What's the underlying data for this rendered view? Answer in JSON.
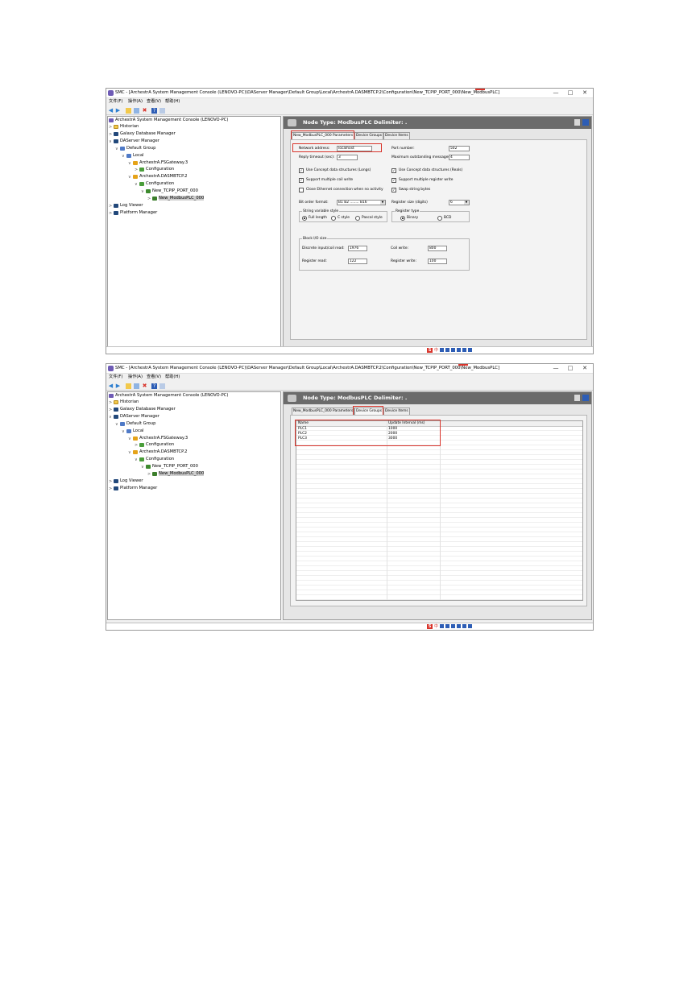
{
  "window": {
    "title": "SMC - [ArchestrA System Management Console (LENOVO-PC)\\DAServer Manager\\Default Group\\Local\\ArchestrA.DASMBTCP.2\\Configuration\\New_TCPIP_PORT_000\\New_ModbusPLC]",
    "controls": {
      "minimize": "—",
      "maximize": "8",
      "close": "✕"
    }
  },
  "menu": [
    "文件(F)",
    "操作(A)",
    "查看(V)",
    "帮助(H)"
  ],
  "toolbar_icons": [
    "back-icon",
    "forward-icon",
    "folder-icon",
    "grid-icon",
    "delete-icon",
    "help-icon",
    "window-icon"
  ],
  "tree": {
    "root": "ArchestrA System Management Console (LENOVO-PC)",
    "historian": "Historian",
    "galaxy": "Galaxy Database Manager",
    "daserver": "DAServer Manager",
    "default_group": "Default Group",
    "local": "Local",
    "fsgateway": "ArchestrA.FSGateway.3",
    "configuration": "Configuration",
    "dasmbtcp": "ArchestrA.DASMBTCP.2",
    "port": "New_TCPIP_PORT_000",
    "plc": "New_ModbusPLC_000",
    "log_viewer": "Log Viewer",
    "platform": "Platform Manager"
  },
  "header": {
    "node_type": "Node Type: ModbusPLC",
    "delimiter": "Delimiter: ."
  },
  "tabs": [
    "New_ModbusPLC_000 Parameters",
    "Device Groups",
    "Device Items"
  ],
  "params": {
    "network_address_label": "Network address:",
    "network_address_value": "localhost",
    "port_number_label": "Port number:",
    "port_number_value": "502",
    "reply_timeout_label": "Reply timeout (sec):",
    "reply_timeout_value": "3",
    "max_outstanding_label": "Maximum outstanding messages:",
    "max_outstanding_value": "4",
    "cb_concept_longs": "Use Concept data structures (Longs)",
    "cb_concept_reals": "Use Concept data structures (Reals)",
    "cb_multi_coil": "Support multiple coil write",
    "cb_multi_register": "Support multiple register write",
    "cb_close_ethernet": "Close Ethernet connection when no activity",
    "cb_swap_string": "Swap string bytes",
    "bit_order_label": "Bit order format:",
    "bit_order_value": "B1 B2 ........ B16",
    "register_size_label": "Register size (digits)",
    "register_size_value": "6",
    "string_style_title": "String variable style",
    "string_full": "Full length",
    "string_c": "C style",
    "string_pascal": "Pascal style",
    "register_type_title": "Register type",
    "register_binary": "Binary",
    "register_bcd": "BCD",
    "block_io_title": "Block I/O size",
    "discrete_label": "Discrete input/coil read:",
    "discrete_value": "1976",
    "coil_write_label": "Coil write:",
    "coil_write_value": "800",
    "register_read_label": "Register read:",
    "register_read_value": "122",
    "register_write_label": "Register write:",
    "register_write_value": "100"
  },
  "device_groups": {
    "columns": [
      "Name",
      "Update Interval (ms)"
    ],
    "rows": [
      {
        "name": "PLC1",
        "interval": "1000"
      },
      {
        "name": "PLC2",
        "interval": "2000"
      },
      {
        "name": "PLC3",
        "interval": "3000"
      }
    ]
  },
  "taskbar": {
    "ime_s": "S",
    "ime_zh": "中",
    "ime_symbols": "☽ ° ⌨ ♙ ⚑ ⚒"
  }
}
